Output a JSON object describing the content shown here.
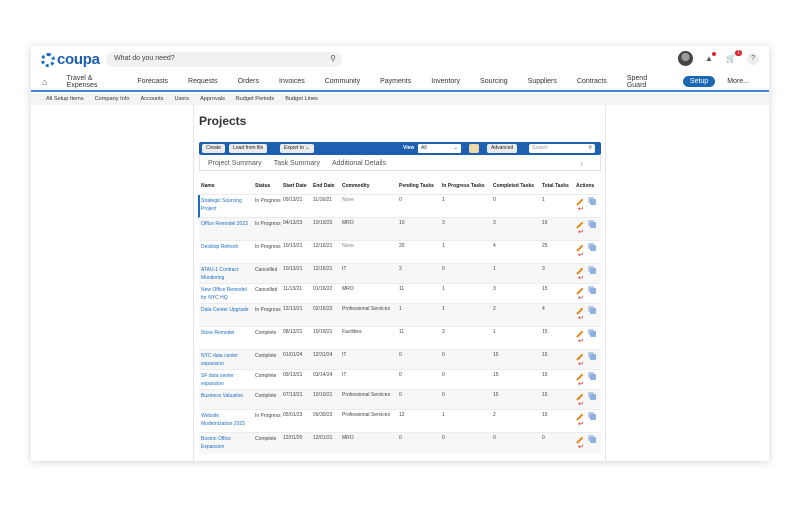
{
  "header": {
    "logo": "coupa",
    "search_placeholder": "What do you need?",
    "cart_count": "1",
    "help": "?"
  },
  "nav": [
    "Travel & Expenses",
    "Forecasts",
    "Requests",
    "Orders",
    "Invoices",
    "Community",
    "Payments",
    "Inventory",
    "Sourcing",
    "Suppliers",
    "Contracts",
    "Spend Guard",
    "Setup",
    "More..."
  ],
  "subnav": [
    "All Setup Items",
    "Company Info",
    "Accounts",
    "Users",
    "Approvals",
    "Budget Periods",
    "Budget Lines"
  ],
  "page": {
    "title": "Projects",
    "toolbar": {
      "create": "Create",
      "load": "Load from file",
      "export": "Export to",
      "view_label": "View",
      "view_value": "All",
      "advanced": "Advanced",
      "search_placeholder": "Search"
    },
    "tabs": [
      "Project Summary",
      "Task Summary",
      "Additional Details"
    ]
  },
  "table": {
    "headers": [
      "Name",
      "Status",
      "Start Date",
      "End Date",
      "Commodity",
      "Pending Tasks",
      "In Progress Tasks",
      "Completed Tasks",
      "Total Tasks",
      "Actions"
    ],
    "rows": [
      {
        "name": "Strategic Sourcing Project",
        "status": "In Progress",
        "start": "09/13/21",
        "end": "11/16/21",
        "commodity": "None",
        "pending": "0",
        "inprog": "1",
        "completed": "0",
        "total": "1"
      },
      {
        "name": "Office Remodel 2023",
        "status": "In Progress",
        "start": "04/13/23",
        "end": "10/19/23",
        "commodity": "MRO",
        "pending": "10",
        "inprog": "3",
        "completed": "3",
        "total": "16"
      },
      {
        "name": "Desktop Refresh",
        "status": "In Progress",
        "start": "10/13/21",
        "end": "12/16/21",
        "commodity": "None",
        "pending": "20",
        "inprog": "1",
        "completed": "4",
        "total": "25"
      },
      {
        "name": "ATAU-1 Contract Monitoring",
        "status": "Cancelled",
        "start": "10/13/21",
        "end": "12/16/21",
        "commodity": "IT",
        "pending": "2",
        "inprog": "0",
        "completed": "1",
        "total": "3"
      },
      {
        "name": "New Office Remodel for NYC HQ",
        "status": "Cancelled",
        "start": "11/13/21",
        "end": "01/16/22",
        "commodity": "MRO",
        "pending": "11",
        "inprog": "1",
        "completed": "3",
        "total": "15"
      },
      {
        "name": "Data Center Upgrade",
        "status": "In Progress",
        "start": "12/13/21",
        "end": "02/16/22",
        "commodity": "Professional Services",
        "pending": "1",
        "inprog": "1",
        "completed": "2",
        "total": "4"
      },
      {
        "name": "Store Remodel",
        "status": "Complete",
        "start": "08/13/21",
        "end": "10/19/21",
        "commodity": "Facilities",
        "pending": "11",
        "inprog": "3",
        "completed": "1",
        "total": "15"
      },
      {
        "name": "NYC data center expansion",
        "status": "Complete",
        "start": "01/01/24",
        "end": "12/31/24",
        "commodity": "IT",
        "pending": "0",
        "inprog": "0",
        "completed": "15",
        "total": "15"
      },
      {
        "name": "SF data center expansion",
        "status": "Complete",
        "start": "09/13/21",
        "end": "03/14/24",
        "commodity": "IT",
        "pending": "0",
        "inprog": "0",
        "completed": "15",
        "total": "15"
      },
      {
        "name": "Business Valuation",
        "status": "Complete",
        "start": "07/13/21",
        "end": "10/10/21",
        "commodity": "Professional Services",
        "pending": "0",
        "inprog": "0",
        "completed": "15",
        "total": "15"
      },
      {
        "name": "Website Modernization 2023",
        "status": "In Progress",
        "start": "05/01/23",
        "end": "09/30/23",
        "commodity": "Professional Services",
        "pending": "12",
        "inprog": "1",
        "completed": "2",
        "total": "15"
      },
      {
        "name": "Boston Office Expansion",
        "status": "Complete",
        "start": "12/01/20",
        "end": "12/01/21",
        "commodity": "MRO",
        "pending": "0",
        "inprog": "0",
        "completed": "0",
        "total": "0"
      }
    ]
  }
}
